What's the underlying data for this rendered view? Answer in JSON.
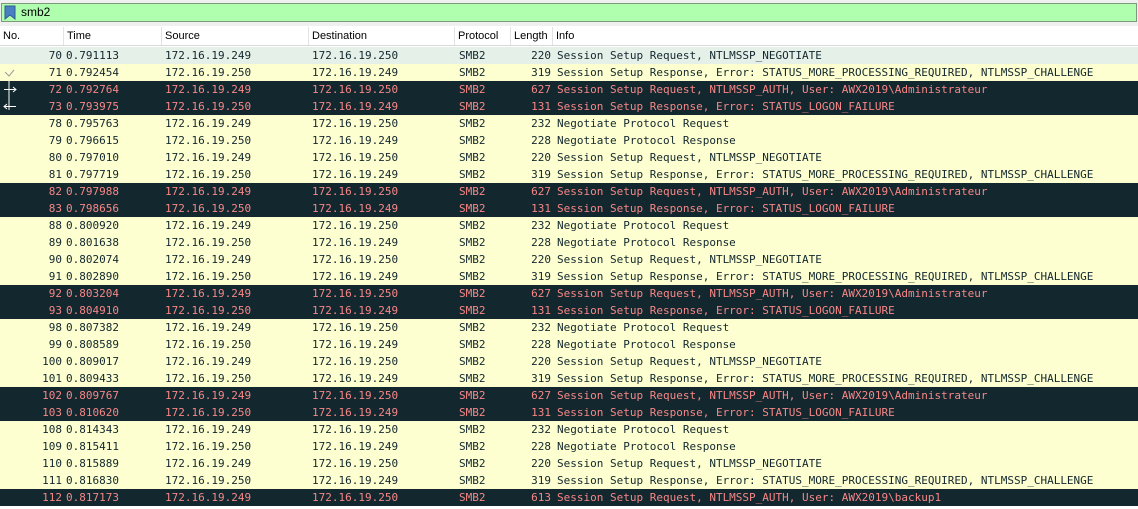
{
  "filter": {
    "text": "smb2",
    "background": "#afffaf"
  },
  "columns": [
    "No.",
    "Time",
    "Source",
    "Destination",
    "Protocol",
    "Length",
    "Info"
  ],
  "colors": {
    "light_row": "#feffd0",
    "dark_row": "#12272e",
    "dark_text": "#f78787",
    "selected_row": "#e4f0e8"
  },
  "rows": [
    {
      "no": "70",
      "time": "0.791113",
      "src": "172.16.19.249",
      "dst": "172.16.19.250",
      "proto": "SMB2",
      "len": "220",
      "info": "Session Setup Request, NTLMSSP_NEGOTIATE",
      "style": "sel",
      "mark": "none"
    },
    {
      "no": "71",
      "time": "0.792454",
      "src": "172.16.19.250",
      "dst": "172.16.19.249",
      "proto": "SMB2",
      "len": "319",
      "info": "Session Setup Response, Error: STATUS_MORE_PROCESSING_REQUIRED, NTLMSSP_CHALLENGE",
      "style": "light",
      "mark": "check"
    },
    {
      "no": "72",
      "time": "0.792764",
      "src": "172.16.19.249",
      "dst": "172.16.19.250",
      "proto": "SMB2",
      "len": "627",
      "info": "Session Setup Request, NTLMSSP_AUTH, User: AWX2019\\Administrateur",
      "style": "dark",
      "mark": "request"
    },
    {
      "no": "73",
      "time": "0.793975",
      "src": "172.16.19.250",
      "dst": "172.16.19.249",
      "proto": "SMB2",
      "len": "131",
      "info": "Session Setup Response, Error: STATUS_LOGON_FAILURE",
      "style": "dark",
      "mark": "response"
    },
    {
      "no": "78",
      "time": "0.795763",
      "src": "172.16.19.249",
      "dst": "172.16.19.250",
      "proto": "SMB2",
      "len": "232",
      "info": "Negotiate Protocol Request",
      "style": "light",
      "mark": "none"
    },
    {
      "no": "79",
      "time": "0.796615",
      "src": "172.16.19.250",
      "dst": "172.16.19.249",
      "proto": "SMB2",
      "len": "228",
      "info": "Negotiate Protocol Response",
      "style": "light",
      "mark": "none"
    },
    {
      "no": "80",
      "time": "0.797010",
      "src": "172.16.19.249",
      "dst": "172.16.19.250",
      "proto": "SMB2",
      "len": "220",
      "info": "Session Setup Request, NTLMSSP_NEGOTIATE",
      "style": "light",
      "mark": "none"
    },
    {
      "no": "81",
      "time": "0.797719",
      "src": "172.16.19.250",
      "dst": "172.16.19.249",
      "proto": "SMB2",
      "len": "319",
      "info": "Session Setup Response, Error: STATUS_MORE_PROCESSING_REQUIRED, NTLMSSP_CHALLENGE",
      "style": "light",
      "mark": "none"
    },
    {
      "no": "82",
      "time": "0.797988",
      "src": "172.16.19.249",
      "dst": "172.16.19.250",
      "proto": "SMB2",
      "len": "627",
      "info": "Session Setup Request, NTLMSSP_AUTH, User: AWX2019\\Administrateur",
      "style": "dark",
      "mark": "none"
    },
    {
      "no": "83",
      "time": "0.798656",
      "src": "172.16.19.250",
      "dst": "172.16.19.249",
      "proto": "SMB2",
      "len": "131",
      "info": "Session Setup Response, Error: STATUS_LOGON_FAILURE",
      "style": "dark",
      "mark": "none"
    },
    {
      "no": "88",
      "time": "0.800920",
      "src": "172.16.19.249",
      "dst": "172.16.19.250",
      "proto": "SMB2",
      "len": "232",
      "info": "Negotiate Protocol Request",
      "style": "light",
      "mark": "none"
    },
    {
      "no": "89",
      "time": "0.801638",
      "src": "172.16.19.250",
      "dst": "172.16.19.249",
      "proto": "SMB2",
      "len": "228",
      "info": "Negotiate Protocol Response",
      "style": "light",
      "mark": "none"
    },
    {
      "no": "90",
      "time": "0.802074",
      "src": "172.16.19.249",
      "dst": "172.16.19.250",
      "proto": "SMB2",
      "len": "220",
      "info": "Session Setup Request, NTLMSSP_NEGOTIATE",
      "style": "light",
      "mark": "none"
    },
    {
      "no": "91",
      "time": "0.802890",
      "src": "172.16.19.250",
      "dst": "172.16.19.249",
      "proto": "SMB2",
      "len": "319",
      "info": "Session Setup Response, Error: STATUS_MORE_PROCESSING_REQUIRED, NTLMSSP_CHALLENGE",
      "style": "light",
      "mark": "none"
    },
    {
      "no": "92",
      "time": "0.803204",
      "src": "172.16.19.249",
      "dst": "172.16.19.250",
      "proto": "SMB2",
      "len": "627",
      "info": "Session Setup Request, NTLMSSP_AUTH, User: AWX2019\\Administrateur",
      "style": "dark",
      "mark": "none"
    },
    {
      "no": "93",
      "time": "0.804910",
      "src": "172.16.19.250",
      "dst": "172.16.19.249",
      "proto": "SMB2",
      "len": "131",
      "info": "Session Setup Response, Error: STATUS_LOGON_FAILURE",
      "style": "dark",
      "mark": "none"
    },
    {
      "no": "98",
      "time": "0.807382",
      "src": "172.16.19.249",
      "dst": "172.16.19.250",
      "proto": "SMB2",
      "len": "232",
      "info": "Negotiate Protocol Request",
      "style": "light",
      "mark": "none"
    },
    {
      "no": "99",
      "time": "0.808589",
      "src": "172.16.19.250",
      "dst": "172.16.19.249",
      "proto": "SMB2",
      "len": "228",
      "info": "Negotiate Protocol Response",
      "style": "light",
      "mark": "none"
    },
    {
      "no": "100",
      "time": "0.809017",
      "src": "172.16.19.249",
      "dst": "172.16.19.250",
      "proto": "SMB2",
      "len": "220",
      "info": "Session Setup Request, NTLMSSP_NEGOTIATE",
      "style": "light",
      "mark": "none"
    },
    {
      "no": "101",
      "time": "0.809433",
      "src": "172.16.19.250",
      "dst": "172.16.19.249",
      "proto": "SMB2",
      "len": "319",
      "info": "Session Setup Response, Error: STATUS_MORE_PROCESSING_REQUIRED, NTLMSSP_CHALLENGE",
      "style": "light",
      "mark": "none"
    },
    {
      "no": "102",
      "time": "0.809767",
      "src": "172.16.19.249",
      "dst": "172.16.19.250",
      "proto": "SMB2",
      "len": "627",
      "info": "Session Setup Request, NTLMSSP_AUTH, User: AWX2019\\Administrateur",
      "style": "dark",
      "mark": "none"
    },
    {
      "no": "103",
      "time": "0.810620",
      "src": "172.16.19.250",
      "dst": "172.16.19.249",
      "proto": "SMB2",
      "len": "131",
      "info": "Session Setup Response, Error: STATUS_LOGON_FAILURE",
      "style": "dark",
      "mark": "none"
    },
    {
      "no": "108",
      "time": "0.814343",
      "src": "172.16.19.249",
      "dst": "172.16.19.250",
      "proto": "SMB2",
      "len": "232",
      "info": "Negotiate Protocol Request",
      "style": "light",
      "mark": "none"
    },
    {
      "no": "109",
      "time": "0.815411",
      "src": "172.16.19.250",
      "dst": "172.16.19.249",
      "proto": "SMB2",
      "len": "228",
      "info": "Negotiate Protocol Response",
      "style": "light",
      "mark": "none"
    },
    {
      "no": "110",
      "time": "0.815889",
      "src": "172.16.19.249",
      "dst": "172.16.19.250",
      "proto": "SMB2",
      "len": "220",
      "info": "Session Setup Request, NTLMSSP_NEGOTIATE",
      "style": "light",
      "mark": "none"
    },
    {
      "no": "111",
      "time": "0.816830",
      "src": "172.16.19.250",
      "dst": "172.16.19.249",
      "proto": "SMB2",
      "len": "319",
      "info": "Session Setup Response, Error: STATUS_MORE_PROCESSING_REQUIRED, NTLMSSP_CHALLENGE",
      "style": "light",
      "mark": "none"
    },
    {
      "no": "112",
      "time": "0.817173",
      "src": "172.16.19.249",
      "dst": "172.16.19.250",
      "proto": "SMB2",
      "len": "613",
      "info": "Session Setup Request, NTLMSSP_AUTH, User: AWX2019\\backup1",
      "style": "dark",
      "mark": "none"
    }
  ]
}
